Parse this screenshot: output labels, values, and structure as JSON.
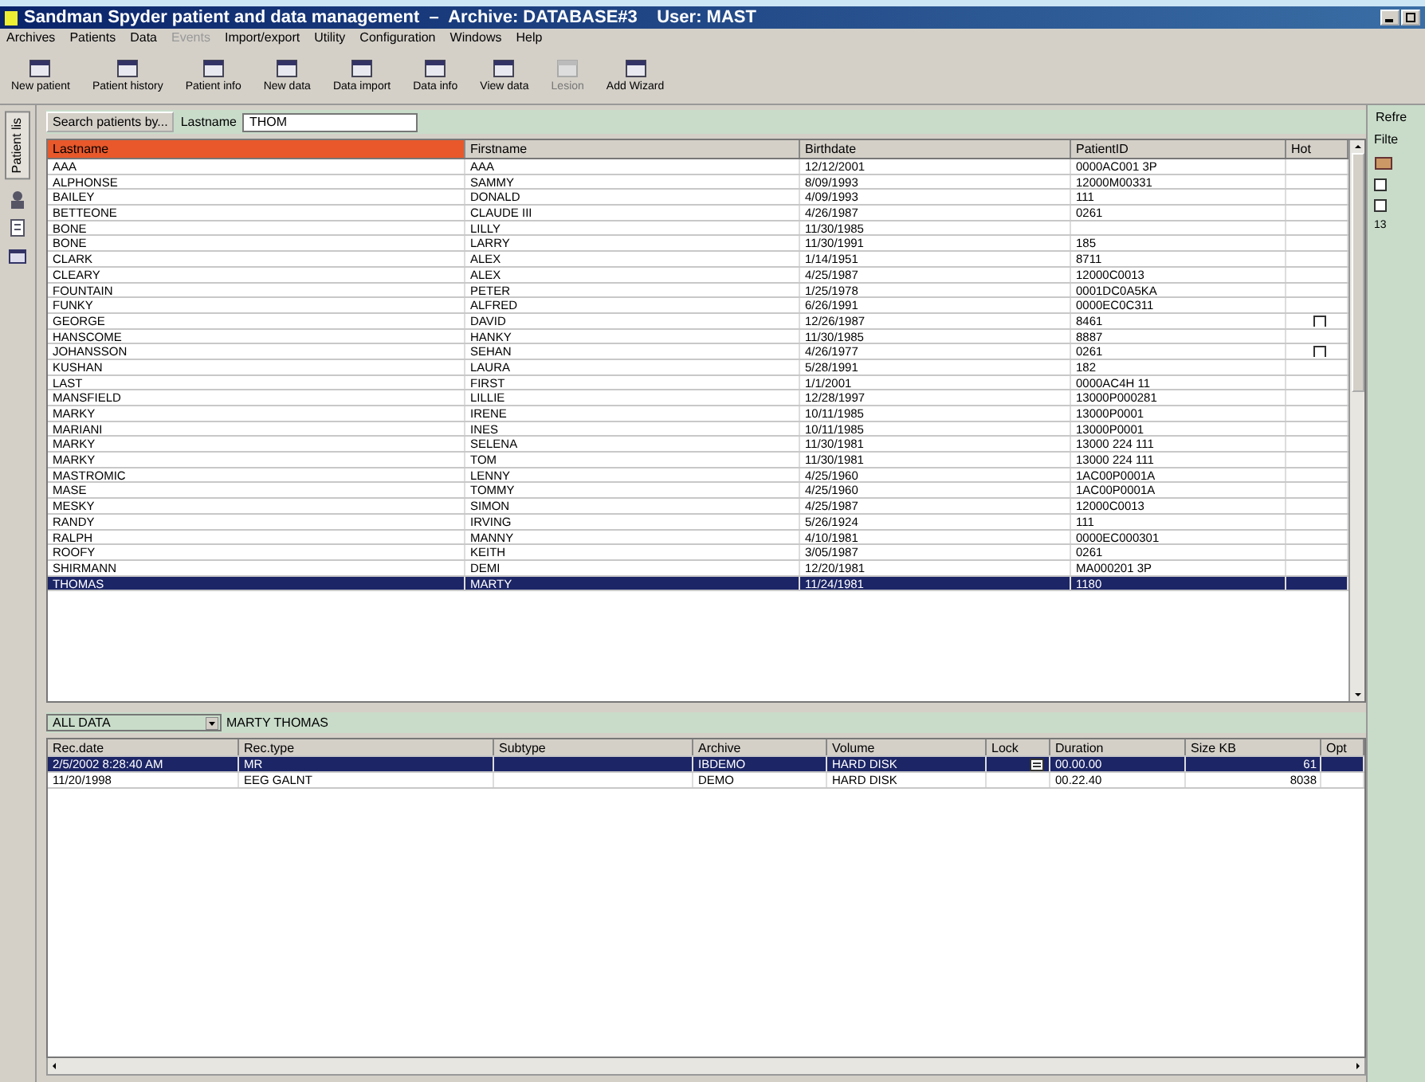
{
  "window": {
    "title": "Sandman Spyder patient and data management  –  Archive: DATABASE#3    User: MAST"
  },
  "menu": [
    {
      "label": "Archives",
      "disabled": false
    },
    {
      "label": "Patients",
      "disabled": false
    },
    {
      "label": "Data",
      "disabled": false
    },
    {
      "label": "Events",
      "disabled": true
    },
    {
      "label": "Import/export",
      "disabled": false
    },
    {
      "label": "Utility",
      "disabled": false
    },
    {
      "label": "Configuration",
      "disabled": false
    },
    {
      "label": "Windows",
      "disabled": false
    },
    {
      "label": "Help",
      "disabled": false
    }
  ],
  "toolbar": [
    {
      "label": "New patient",
      "disabled": false
    },
    {
      "label": "Patient history",
      "disabled": false
    },
    {
      "label": "Patient info",
      "disabled": false
    },
    {
      "label": "New data",
      "disabled": false
    },
    {
      "label": "Data import",
      "disabled": false
    },
    {
      "label": "Data info",
      "disabled": false
    },
    {
      "label": "View data",
      "disabled": false
    },
    {
      "label": "Lesion",
      "disabled": true
    },
    {
      "label": "Add Wizard",
      "disabled": false
    }
  ],
  "side_tab": {
    "label": "Patient lis"
  },
  "search": {
    "button": "Search patients by...",
    "field_label": "Lastname",
    "value": "THOM"
  },
  "refresh": {
    "label": "Refre"
  },
  "filter_panel": {
    "label": "Filte",
    "checkboxes": [
      {
        "checked": false
      },
      {
        "checked": false
      }
    ],
    "count": "13"
  },
  "patients": {
    "columns": [
      {
        "label": "Lastname",
        "sorted": true
      },
      {
        "label": "Firstname",
        "sorted": false
      },
      {
        "label": "Birthdate",
        "sorted": false
      },
      {
        "label": "PatientID",
        "sorted": false
      },
      {
        "label": "Hot",
        "sorted": false
      }
    ],
    "rows": [
      {
        "cells": [
          "AAA",
          "AAA",
          "12/12/2001",
          "0000AC001 3P"
        ],
        "hot_box": false,
        "selected": false
      },
      {
        "cells": [
          "ALPHONSE",
          "SAMMY",
          "8/09/1993",
          "12000M00331"
        ],
        "hot_box": false,
        "selected": false
      },
      {
        "cells": [
          "BAILEY",
          "DONALD",
          "4/09/1993",
          "111"
        ],
        "hot_box": false,
        "selected": false
      },
      {
        "cells": [
          "BETTEONE",
          "CLAUDE III",
          "4/26/1987",
          "0261"
        ],
        "hot_box": false,
        "selected": false
      },
      {
        "cells": [
          "BONE",
          "LILLY",
          "11/30/1985",
          ""
        ],
        "hot_box": false,
        "selected": false
      },
      {
        "cells": [
          "BONE",
          "LARRY",
          "11/30/1991",
          "185"
        ],
        "hot_box": false,
        "selected": false
      },
      {
        "cells": [
          "CLARK",
          "ALEX",
          "1/14/1951",
          "8711"
        ],
        "hot_box": false,
        "selected": false
      },
      {
        "cells": [
          "CLEARY",
          "ALEX",
          "4/25/1987",
          "12000C0013"
        ],
        "hot_box": false,
        "selected": false
      },
      {
        "cells": [
          "FOUNTAIN",
          "PETER",
          "1/25/1978",
          "0001DC0A5KA"
        ],
        "hot_box": false,
        "selected": false
      },
      {
        "cells": [
          "FUNKY",
          "ALFRED",
          "6/26/1991",
          "0000EC0C311"
        ],
        "hot_box": false,
        "selected": false
      },
      {
        "cells": [
          "GEORGE",
          "DAVID",
          "12/26/1987",
          "8461"
        ],
        "hot_box": true,
        "selected": false
      },
      {
        "cells": [
          "HANSCOME",
          "HANKY",
          "11/30/1985",
          "8887"
        ],
        "hot_box": false,
        "selected": false
      },
      {
        "cells": [
          "JOHANSSON",
          "SEHAN",
          "4/26/1977",
          "0261"
        ],
        "hot_box": true,
        "selected": false
      },
      {
        "cells": [
          "KUSHAN",
          "LAURA",
          "5/28/1991",
          "182"
        ],
        "hot_box": false,
        "selected": false
      },
      {
        "cells": [
          "LAST",
          "FIRST",
          "1/1/2001",
          "0000AC4H 11"
        ],
        "hot_box": false,
        "selected": false
      },
      {
        "cells": [
          "MANSFIELD",
          "LILLIE",
          "12/28/1997",
          "13000P000281"
        ],
        "hot_box": false,
        "selected": false
      },
      {
        "cells": [
          "MARKY",
          "IRENE",
          "10/11/1985",
          "13000P0001"
        ],
        "hot_box": false,
        "selected": false
      },
      {
        "cells": [
          "MARIANI",
          "INES",
          "10/11/1985",
          "13000P0001"
        ],
        "hot_box": false,
        "selected": false
      },
      {
        "cells": [
          "MARKY",
          "SELENA",
          "11/30/1981",
          "13000 224 111"
        ],
        "hot_box": false,
        "selected": false
      },
      {
        "cells": [
          "MARKY",
          "TOM",
          "11/30/1981",
          "13000 224 111"
        ],
        "hot_box": false,
        "selected": false
      },
      {
        "cells": [
          "MASTROMIC",
          "LENNY",
          "4/25/1960",
          "1AC00P0001A"
        ],
        "hot_box": false,
        "selected": false
      },
      {
        "cells": [
          "MASE",
          "TOMMY",
          "4/25/1960",
          "1AC00P0001A"
        ],
        "hot_box": false,
        "selected": false
      },
      {
        "cells": [
          "MESKY",
          "SIMON",
          "4/25/1987",
          "12000C0013"
        ],
        "hot_box": false,
        "selected": false
      },
      {
        "cells": [
          "RANDY",
          "IRVING",
          "5/26/1924",
          "111"
        ],
        "hot_box": false,
        "selected": false
      },
      {
        "cells": [
          "RALPH",
          "MANNY",
          "4/10/1981",
          "0000EC000301"
        ],
        "hot_box": false,
        "selected": false
      },
      {
        "cells": [
          "ROOFY",
          "KEITH",
          "3/05/1987",
          "0261"
        ],
        "hot_box": false,
        "selected": false
      },
      {
        "cells": [
          "SHIRMANN",
          "DEMI",
          "12/20/1981",
          "MA000201 3P"
        ],
        "hot_box": false,
        "selected": false
      },
      {
        "cells": [
          "THOMAS",
          "MARTY",
          "11/24/1981",
          "1180"
        ],
        "hot_box": false,
        "selected": true
      }
    ]
  },
  "data": {
    "filter": "ALL DATA",
    "patient": "MARTY THOMAS",
    "columns": [
      "Rec.date",
      "Rec.type",
      "Subtype",
      "Archive",
      "Volume",
      "Lock",
      "Duration",
      "Size KB",
      "Opt"
    ],
    "rows": [
      {
        "cells": [
          "2/5/2002 8:28:40 AM",
          "MR",
          "",
          "IBDEMO",
          "HARD DISK",
          "",
          "00.00.00",
          "61",
          ""
        ],
        "locked": true,
        "selected": true
      },
      {
        "cells": [
          "11/20/1998",
          "EEG GALNT",
          "",
          "DEMO",
          "HARD DISK",
          "",
          "00.22.40",
          "8038",
          ""
        ],
        "locked": false,
        "selected": false
      }
    ]
  }
}
